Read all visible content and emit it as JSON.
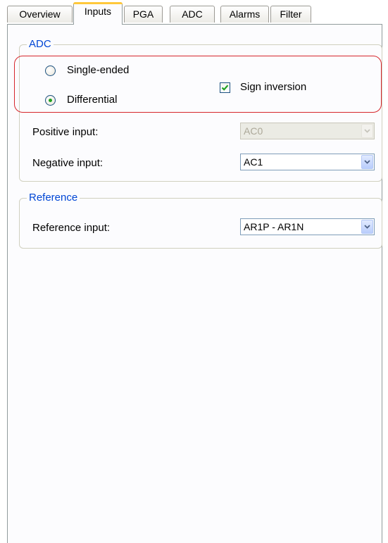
{
  "tabs": [
    {
      "label": "Overview"
    },
    {
      "label": "Inputs"
    },
    {
      "label": "PGA"
    },
    {
      "label": "ADC"
    },
    {
      "label": "Alarms"
    },
    {
      "label": "Filter"
    }
  ],
  "active_tab": "Inputs",
  "adc_group": {
    "title": "ADC",
    "mode_options": [
      {
        "label": "Single-ended",
        "selected": false
      },
      {
        "label": "Differential",
        "selected": true
      }
    ],
    "sign_inversion": {
      "label": "Sign inversion",
      "checked": true
    },
    "positive_input": {
      "label": "Positive input:",
      "value": "AC0",
      "enabled": false
    },
    "negative_input": {
      "label": "Negative input:",
      "value": "AC1",
      "enabled": true
    }
  },
  "reference_group": {
    "title": "Reference",
    "reference_input": {
      "label": "Reference input:",
      "value": "AR1P - AR1N"
    }
  },
  "colors": {
    "group_title": "#0046d5",
    "highlight_border": "#d6262c",
    "radio_dot": "#21a121",
    "check_mark": "#21a121",
    "active_tab_accent": "#ffc83c"
  },
  "icons": {
    "dropdown": "chevron-down-icon",
    "checkbox_mark": "checkmark-icon"
  }
}
